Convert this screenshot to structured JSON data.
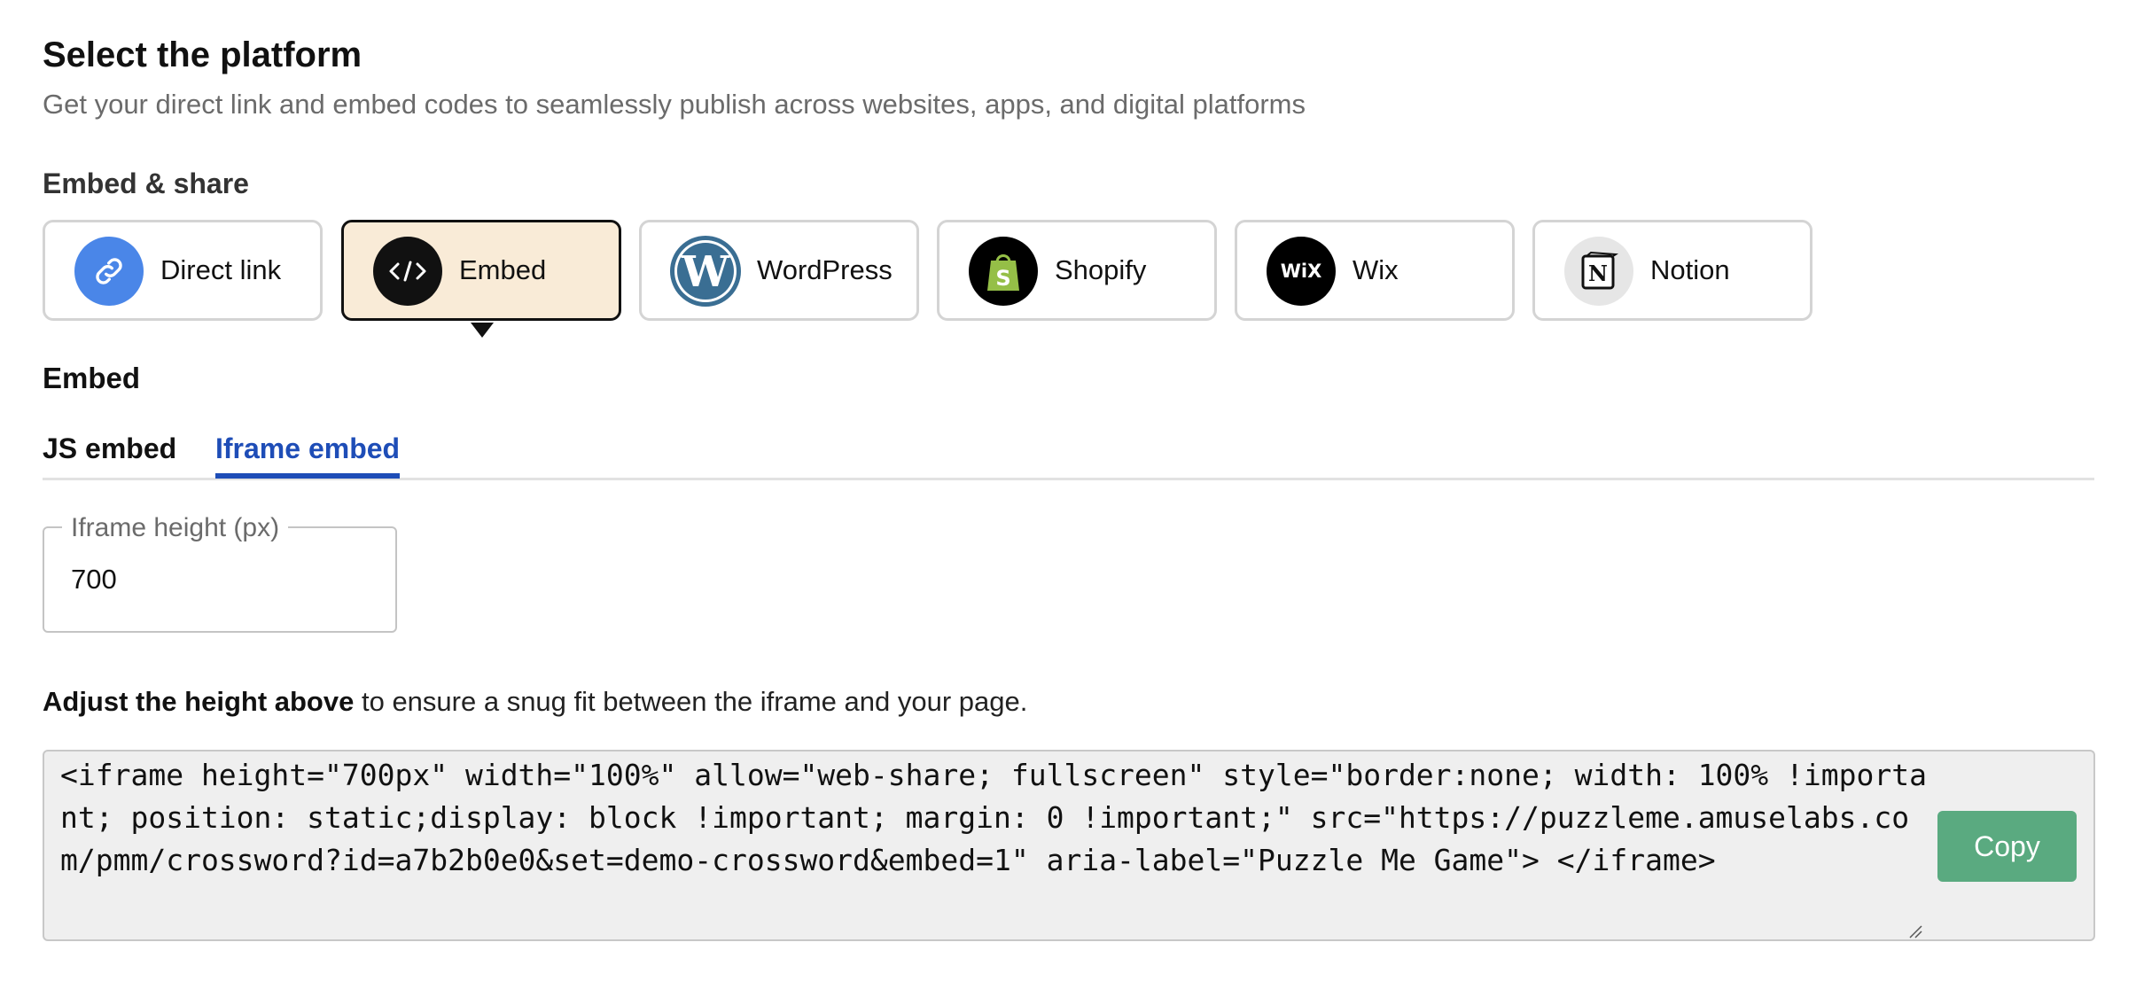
{
  "header": {
    "title": "Select the platform",
    "subtitle": "Get your direct link and embed codes to seamlessly publish across websites, apps, and digital platforms"
  },
  "embed_share": {
    "label": "Embed & share",
    "selected": "Embed",
    "platforms": [
      {
        "label": "Direct link",
        "icon": "link-icon",
        "color": "#4a86e8"
      },
      {
        "label": "Embed",
        "icon": "code-icon",
        "color": "#111111"
      },
      {
        "label": "WordPress",
        "icon": "wordpress-icon",
        "color": "#3a6e93"
      },
      {
        "label": "Shopify",
        "icon": "shopify-icon",
        "color": "#95bf47"
      },
      {
        "label": "Wix",
        "icon": "wix-icon",
        "color": "#111111"
      },
      {
        "label": "Notion",
        "icon": "notion-icon",
        "color": "#e6e6e6"
      }
    ]
  },
  "embed": {
    "heading": "Embed",
    "tabs": [
      {
        "label": "JS embed",
        "active": false
      },
      {
        "label": "Iframe embed",
        "active": true
      }
    ],
    "height_field": {
      "label": "Iframe height (px)",
      "value": "700"
    },
    "hint_bold": "Adjust the height above",
    "hint_rest": " to ensure a snug fit between the iframe and your page.",
    "code": "<iframe height=\"700px\" width=\"100%\" allow=\"web-share; fullscreen\" style=\"border:none; width: 100% !important; position: static;display: block !important; margin: 0 !important;\" src=\"https://puzzleme.amuselabs.com/pmm/crossword?id=a7b2b0e0&set=demo-crossword&embed=1\" aria-label=\"Puzzle Me Game\"> </iframe>",
    "copy_label": "Copy"
  },
  "colors": {
    "accent": "#1e4db7",
    "selected_card_bg": "#f9ebd7",
    "copy_button": "#5aaa80"
  }
}
